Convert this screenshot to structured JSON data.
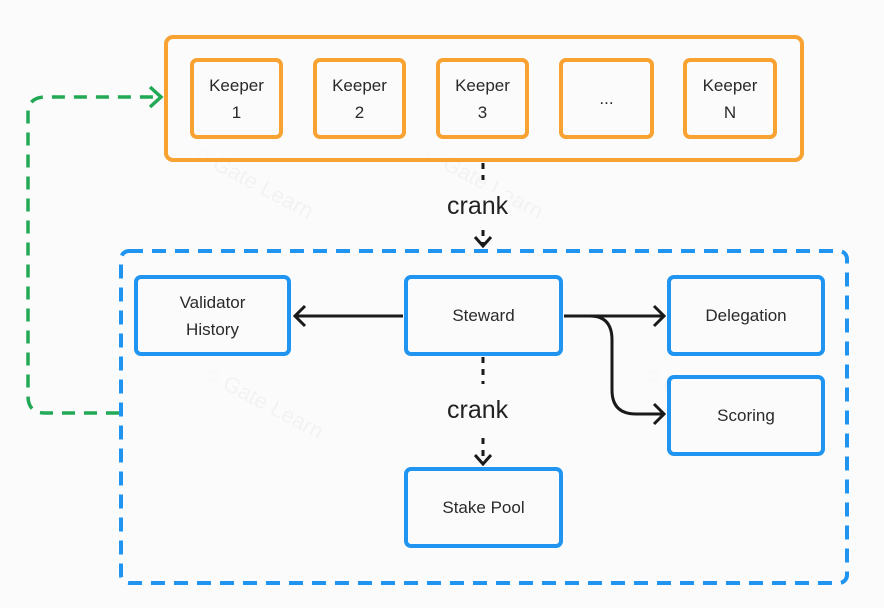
{
  "keepers_group": {
    "keepers": [
      {
        "line1": "Keeper",
        "line2": "1"
      },
      {
        "line1": "Keeper",
        "line2": "2"
      },
      {
        "line1": "Keeper",
        "line2": "3"
      },
      {
        "line1": "...",
        "line2": ""
      },
      {
        "line1": "Keeper",
        "line2": "N"
      }
    ]
  },
  "edges": {
    "crank_top": "crank",
    "crank_bottom": "crank"
  },
  "program_group": {
    "validator_history": {
      "line1": "Validator",
      "line2": "History"
    },
    "steward": "Steward",
    "delegation": "Delegation",
    "scoring": "Scoring",
    "stake_pool": "Stake Pool"
  },
  "colors": {
    "keeper": "#f7a231",
    "program": "#1f94f0",
    "loop": "#22a955",
    "arrow": "#1a1a1a"
  },
  "watermark": "Gate Learn"
}
